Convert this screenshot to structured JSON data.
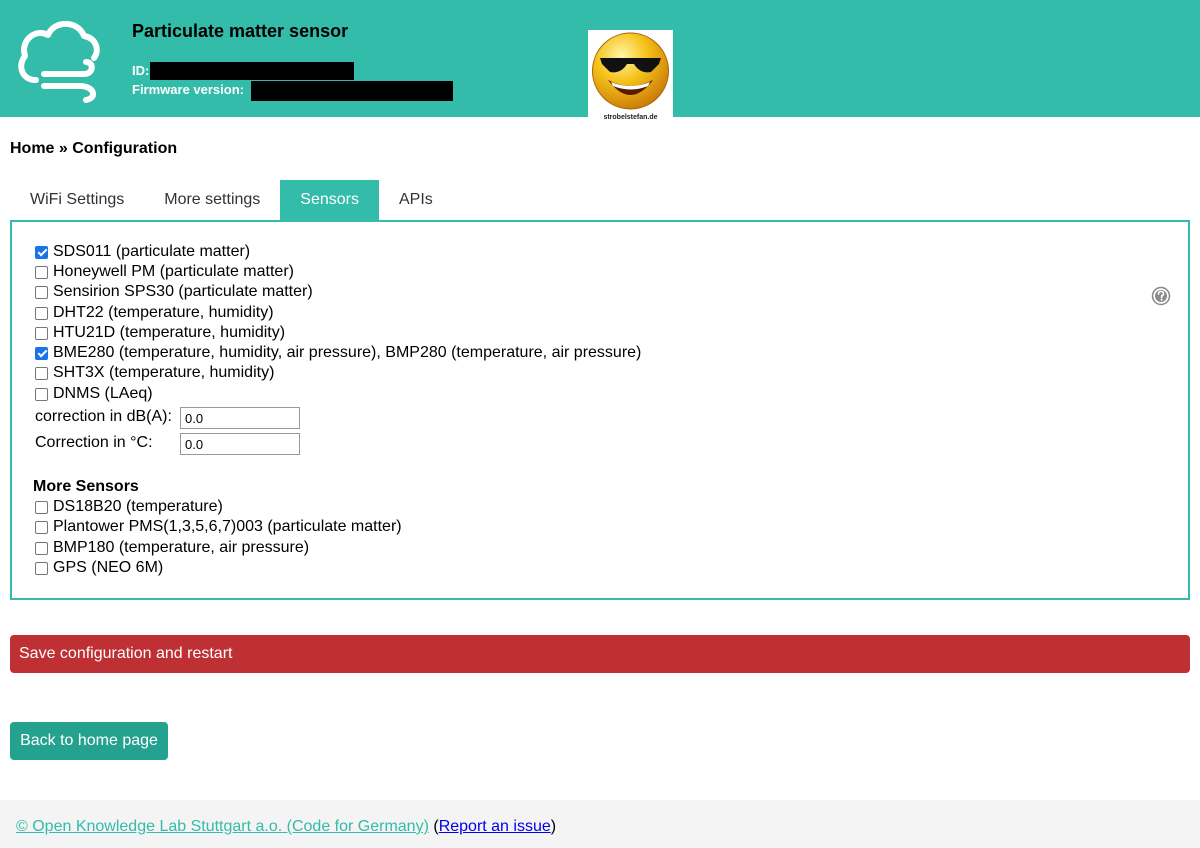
{
  "header": {
    "title": "Particulate matter sensor",
    "id_label": "ID:",
    "firmware_label": "Firmware version:",
    "logo_caption": "strobelstefan.de"
  },
  "breadcrumb": "Home » Configuration",
  "tabs": [
    {
      "label": "WiFi Settings",
      "active": false
    },
    {
      "label": "More settings",
      "active": false
    },
    {
      "label": "Sensors",
      "active": true
    },
    {
      "label": "APIs",
      "active": false
    }
  ],
  "sensors": [
    {
      "label": "SDS011 (particulate matter)",
      "checked": true
    },
    {
      "label": "Honeywell PM (particulate matter)",
      "checked": false
    },
    {
      "label": "Sensirion SPS30 (particulate matter)",
      "checked": false
    },
    {
      "label": "DHT22 (temperature, humidity)",
      "checked": false
    },
    {
      "label": "HTU21D (temperature, humidity)",
      "checked": false
    },
    {
      "label": "BME280 (temperature, humidity, air pressure), BMP280 (temperature, air pressure)",
      "checked": true
    },
    {
      "label": "SHT3X (temperature, humidity)",
      "checked": false
    },
    {
      "label": "DNMS (LAeq)",
      "checked": false
    }
  ],
  "fields": [
    {
      "label": "correction in dB(A):",
      "value": "0.0"
    },
    {
      "label": "Correction in °C:",
      "value": "0.0"
    }
  ],
  "more_sensors_title": "More Sensors",
  "more_sensors": [
    {
      "label": "DS18B20 (temperature)",
      "checked": false
    },
    {
      "label": "Plantower PMS(1,3,5,6,7)003 (particulate matter)",
      "checked": false
    },
    {
      "label": "BMP180 (temperature, air pressure)",
      "checked": false
    },
    {
      "label": "GPS (NEO 6M)",
      "checked": false
    }
  ],
  "save_button": "Save configuration and restart",
  "back_button": "Back to home page",
  "footer": {
    "copyright_link": "© Open Knowledge Lab Stuttgart a.o. (Code for Germany)",
    "open_paren": " (",
    "report_link": "Report an issue",
    "close_paren": ")"
  },
  "colors": {
    "accent": "#33bca9",
    "save": "#bf3034",
    "back": "#25a28f",
    "checkbox_checked": "#1a73e8"
  },
  "icons": {
    "logo": "cloud-wind-icon",
    "brand": "sunglasses-smiley-icon",
    "help": "help-icon"
  }
}
